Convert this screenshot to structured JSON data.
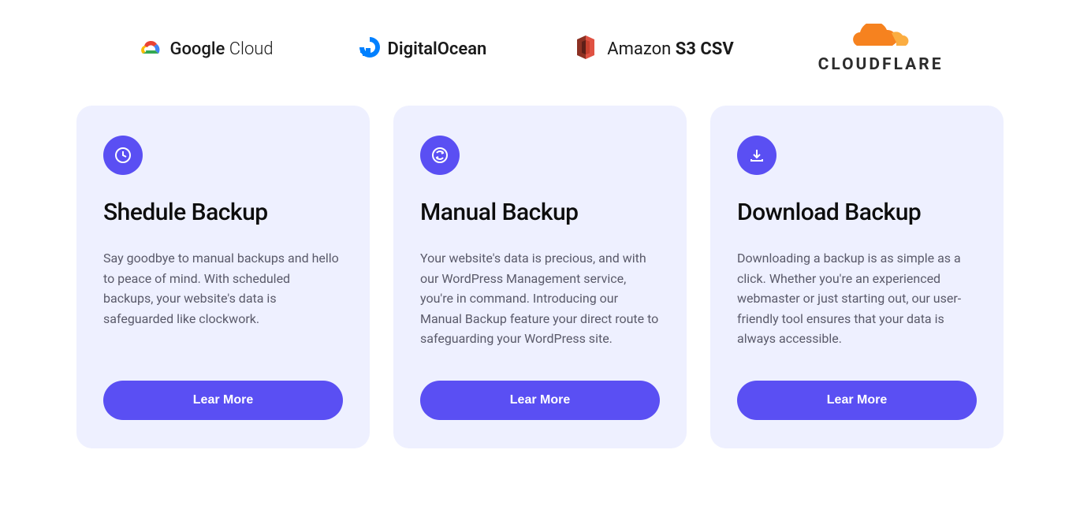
{
  "logos": {
    "google_cloud": "Google Cloud",
    "digitalocean": "DigitalOcean",
    "amazon": "Amazon S3 CSV",
    "cloudflare": "CLOUDFLARE"
  },
  "cards": [
    {
      "icon": "clock",
      "title": "Shedule Backup",
      "desc": "Say goodbye to manual backups and hello to peace of mind. With scheduled backups, your website's data is safeguarded like clockwork.",
      "button": "Lear More"
    },
    {
      "icon": "refresh",
      "title": "Manual Backup",
      "desc": "Your website's data is precious, and with our WordPress Management service, you're in command. Introducing our Manual Backup feature your direct route to safeguarding your WordPress site.",
      "button": "Lear More"
    },
    {
      "icon": "download",
      "title": "Download Backup",
      "desc": "Downloading a backup is as simple as a click. Whether you're an experienced webmaster or just starting out, our user-friendly tool ensures that your data is always accessible.",
      "button": "Lear More"
    }
  ]
}
